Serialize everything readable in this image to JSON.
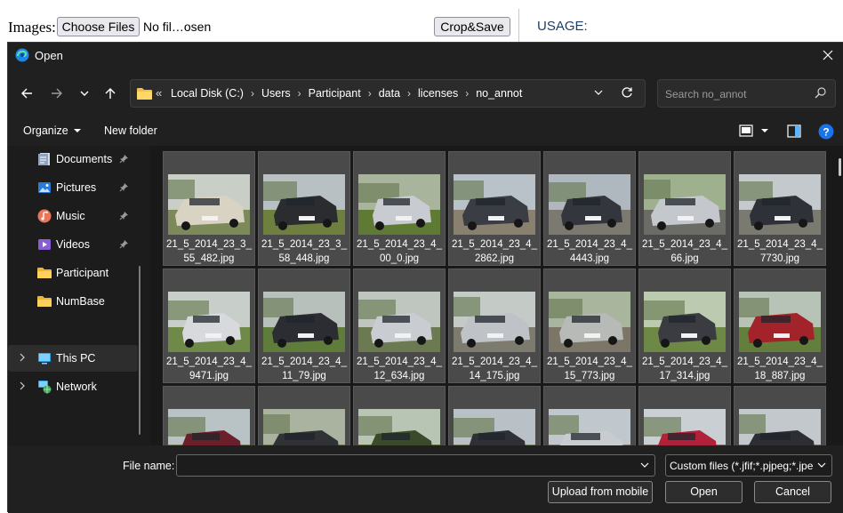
{
  "webpage": {
    "images_label": "Images:",
    "choose_files_label": "Choose Files",
    "file_status": "No fil…osen",
    "crop_save_label": "Crop&Save",
    "usage_label": "USAGE:"
  },
  "dialog": {
    "title": "Open",
    "address": {
      "overflow": "«",
      "crumbs": [
        "Local Disk (C:)",
        "Users",
        "Participant",
        "data",
        "licenses",
        "no_annot"
      ]
    },
    "search_placeholder": "Search no_annot",
    "toolbar": {
      "organize_label": "Organize",
      "new_folder_label": "New folder"
    },
    "sidebar": {
      "items": [
        {
          "label": "Documents",
          "icon": "documents-icon"
        },
        {
          "label": "Pictures",
          "icon": "pictures-icon"
        },
        {
          "label": "Music",
          "icon": "music-icon"
        },
        {
          "label": "Videos",
          "icon": "videos-icon"
        },
        {
          "label": "Participant",
          "icon": "folder-icon"
        },
        {
          "label": "NumBase",
          "icon": "folder-icon"
        },
        {
          "label": "This PC",
          "icon": "this-pc-icon"
        },
        {
          "label": "Network",
          "icon": "network-icon"
        }
      ]
    },
    "files": [
      {
        "name": "21_5_2014_23_3_55_482.jpg",
        "car": "#d9d3c4",
        "ground": "#7c8a5a",
        "sky": "#c9cfc6"
      },
      {
        "name": "21_5_2014_23_3_58_448.jpg",
        "car": "#2a2c30",
        "ground": "#6f7f3f",
        "sky": "#b9c0c4"
      },
      {
        "name": "21_5_2014_23_4_00_0.jpg",
        "car": "#c8ccd0",
        "ground": "#5f7a35",
        "sky": "#a8b49c"
      },
      {
        "name": "21_5_2014_23_4_2862.jpg",
        "car": "#3a3d44",
        "ground": "#8a8070",
        "sky": "#b8c2c8"
      },
      {
        "name": "21_5_2014_23_4_4443.jpg",
        "car": "#33363c",
        "ground": "#7c7a70",
        "sky": "#aeb8be"
      },
      {
        "name": "21_5_2014_23_4_66.jpg",
        "car": "#c4c8cc",
        "ground": "#6c6c66",
        "sky": "#9fb08f"
      },
      {
        "name": "21_5_2014_23_4_7730.jpg",
        "car": "#2e3138",
        "ground": "#7a7a70",
        "sky": "#c3c9cc"
      },
      {
        "name": "21_5_2014_23_4_9471.jpg",
        "car": "#d7d9dc",
        "ground": "#6f8a48",
        "sky": "#c8cfca"
      },
      {
        "name": "21_5_2014_23_4_11_79.jpg",
        "car": "#2b2d32",
        "ground": "#5f7c3a",
        "sky": "#b7c0bb"
      },
      {
        "name": "21_5_2014_23_4_12_634.jpg",
        "car": "#c9cdd1",
        "ground": "#6b7a50",
        "sky": "#bfc6c0"
      },
      {
        "name": "21_5_2014_23_4_14_175.jpg",
        "car": "#bfc3c7",
        "ground": "#7d7a6e",
        "sky": "#c4cac6"
      },
      {
        "name": "21_5_2014_23_4_15_773.jpg",
        "car": "#b8bab8",
        "ground": "#7b7668",
        "sky": "#a9b59c"
      },
      {
        "name": "21_5_2014_23_4_17_314.jpg",
        "car": "#3a3c42",
        "ground": "#6e8846",
        "sky": "#bccbb0"
      },
      {
        "name": "21_5_2014_23_4_18_887.jpg",
        "car": "#a3232b",
        "ground": "#647f3c",
        "sky": "#b7c3b6"
      },
      {
        "name": "",
        "car": "#6b1f2a",
        "ground": "#6f7a5a",
        "sky": "#b9c2c4"
      },
      {
        "name": "",
        "car": "#303236",
        "ground": "#6a7450",
        "sky": "#aab2a0"
      },
      {
        "name": "",
        "car": "#3a4a2a",
        "ground": "#5a6e36",
        "sky": "#b8c4b4"
      },
      {
        "name": "",
        "car": "#2e3036",
        "ground": "#6f7a5c",
        "sky": "#b9c1c6"
      },
      {
        "name": "",
        "car": "#c8cbcf",
        "ground": "#7a7a70",
        "sky": "#c0c8ce"
      },
      {
        "name": "",
        "car": "#b0213a",
        "ground": "#7a6f66",
        "sky": "#c9cfd2"
      },
      {
        "name": "",
        "car": "#2c2e33",
        "ground": "#6f6e68",
        "sky": "#c2c8cc"
      }
    ],
    "footer": {
      "file_name_label": "File name:",
      "file_name_value": "",
      "filter_value": "Custom files (*.jfif;*.pjpeg;*.jpe",
      "upload_label": "Upload from mobile",
      "open_label": "Open",
      "cancel_label": "Cancel"
    },
    "colors": {
      "background": "#1c1c1c",
      "tile": "#4a4a4a",
      "help_blue": "#1a73e8"
    }
  }
}
